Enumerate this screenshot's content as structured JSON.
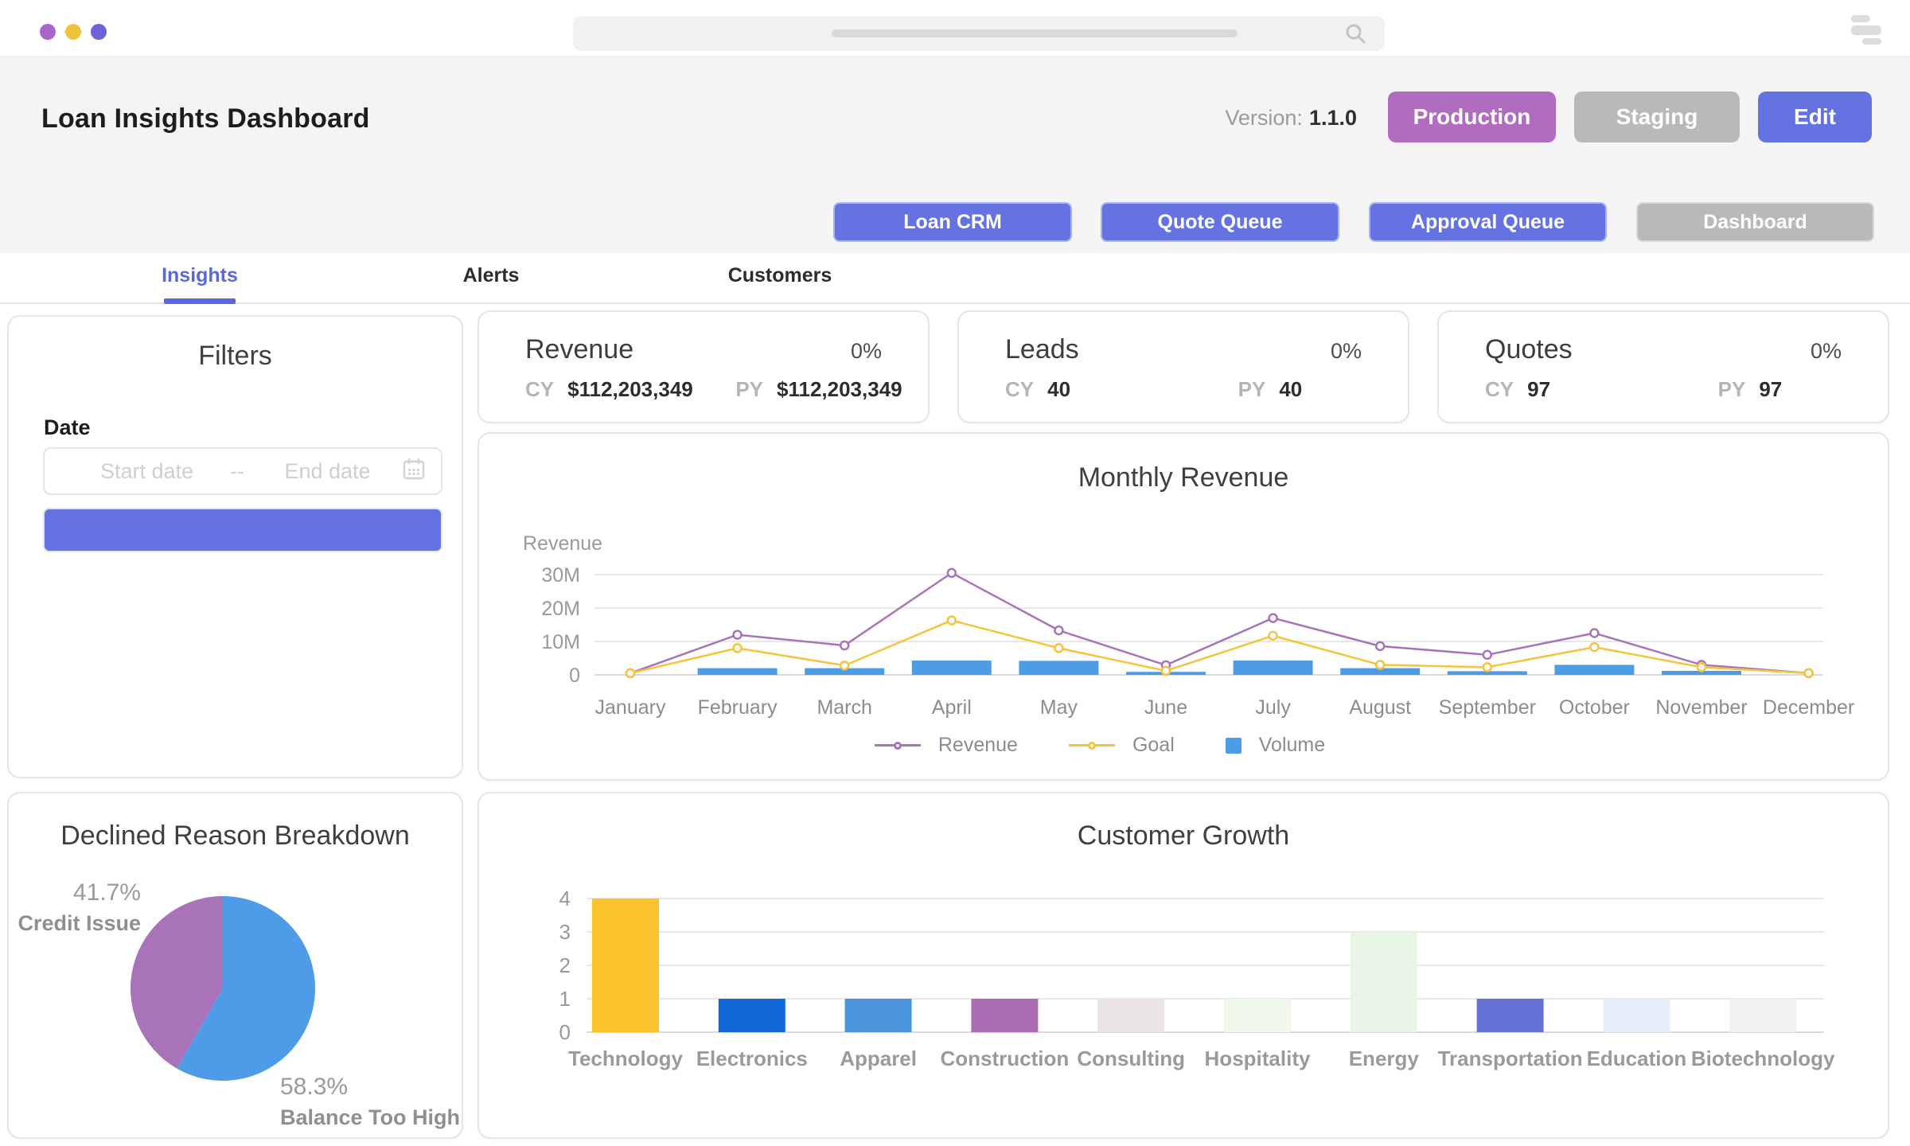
{
  "topbar": {
    "traffic_colors": [
      "#a964c9",
      "#eec43d",
      "#6e62d8"
    ],
    "search_placeholder": "",
    "icons": {
      "search": "magnifier-icon",
      "menu": "stacked-bars-icon",
      "calendar": "calendar-icon"
    }
  },
  "header": {
    "title": "Loan Insights Dashboard",
    "version_label": "Version:",
    "version_value": "1.1.0",
    "env_buttons": [
      {
        "label": "Production",
        "color": "#b16cbf"
      },
      {
        "label": "Staging",
        "color": "#b9b9b9"
      },
      {
        "label": "Edit",
        "color": "#6573e2"
      }
    ],
    "nav_buttons": [
      {
        "label": "Loan CRM",
        "color": "#6573e2"
      },
      {
        "label": "Quote Queue",
        "color": "#6573e2"
      },
      {
        "label": "Approval Queue",
        "color": "#6573e2"
      },
      {
        "label": "Dashboard",
        "color": "#b9b9b9"
      }
    ]
  },
  "tabs": [
    {
      "label": "Insights",
      "active": true
    },
    {
      "label": "Alerts",
      "active": false
    },
    {
      "label": "Customers",
      "active": false
    }
  ],
  "filters": {
    "title": "Filters",
    "date_label": "Date",
    "start_placeholder": "Start date",
    "range_separator": "--",
    "end_placeholder": "End date",
    "apply_button_label": ""
  },
  "kpis": [
    {
      "title": "Revenue",
      "delta": "0%",
      "cy_label": "CY",
      "cy_value": "$112,203,349",
      "py_label": "PY",
      "py_value": "$112,203,349"
    },
    {
      "title": "Leads",
      "delta": "0%",
      "cy_label": "CY",
      "cy_value": "40",
      "py_label": "PY",
      "py_value": "40"
    },
    {
      "title": "Quotes",
      "delta": "0%",
      "cy_label": "CY",
      "cy_value": "97",
      "py_label": "PY",
      "py_value": "97"
    }
  ],
  "chart_data": [
    {
      "id": "monthly_revenue",
      "type": "line+bar",
      "title": "Monthly Revenue",
      "ylabel": "Revenue",
      "unit": "millions",
      "grid": true,
      "legend_position": "bottom",
      "categories": [
        "January",
        "February",
        "March",
        "April",
        "May",
        "June",
        "July",
        "August",
        "September",
        "October",
        "November",
        "December"
      ],
      "yticks": [
        {
          "label": "30M",
          "value": 30
        },
        {
          "label": "20M",
          "value": 20
        },
        {
          "label": "10M",
          "value": 10
        },
        {
          "label": "0",
          "value": 0
        }
      ],
      "ylim": [
        0,
        32
      ],
      "series": [
        {
          "name": "Revenue",
          "type": "line",
          "color": "#a873b9",
          "values": [
            0.5,
            12,
            8.8,
            30.5,
            13.3,
            2.9,
            17,
            8.6,
            6,
            12.5,
            3,
            0.5
          ]
        },
        {
          "name": "Goal",
          "type": "line",
          "color": "#f6c33c",
          "values": [
            0.5,
            8,
            2.8,
            16.3,
            8,
            1.2,
            11.7,
            3,
            2.3,
            8.3,
            2.3,
            0.5
          ]
        },
        {
          "name": "Volume",
          "type": "bar",
          "color": "#4d9ce6",
          "values": [
            0,
            2,
            2,
            4.3,
            4.2,
            0.9,
            4.3,
            2,
            1.1,
            3,
            1.2,
            0
          ]
        }
      ]
    },
    {
      "id": "declined_reasons",
      "type": "pie",
      "title": "Declined Reason Breakdown",
      "slices": [
        {
          "label": "Balance Too High",
          "pct": 58.3,
          "pct_label": "58.3%",
          "color": "#4e9ce8"
        },
        {
          "label": "Credit Issue",
          "pct": 41.7,
          "pct_label": "41.7%",
          "color": "#a873b9"
        }
      ]
    },
    {
      "id": "customer_growth",
      "type": "bar",
      "title": "Customer Growth",
      "grid": true,
      "categories": [
        "Technology",
        "Electronics",
        "Apparel",
        "Construction",
        "Consulting",
        "Hospitality",
        "Energy",
        "Transportation",
        "Education",
        "Biotechnology"
      ],
      "values": [
        4,
        1,
        1,
        1,
        1,
        1,
        3,
        1,
        1,
        1
      ],
      "colors": [
        "#fcc22d",
        "#1267d9",
        "#4b94dc",
        "#ab6db1",
        "#eae4e6",
        "#eff8ea",
        "#e9f5e4",
        "#6672d6",
        "#e4effb",
        "#f0f2ef"
      ],
      "yticks": [
        {
          "label": "4",
          "value": 4
        },
        {
          "label": "3",
          "value": 3
        },
        {
          "label": "2",
          "value": 2
        },
        {
          "label": "1",
          "value": 1
        },
        {
          "label": "0",
          "value": 0
        }
      ],
      "ylim": [
        0,
        4
      ]
    }
  ]
}
